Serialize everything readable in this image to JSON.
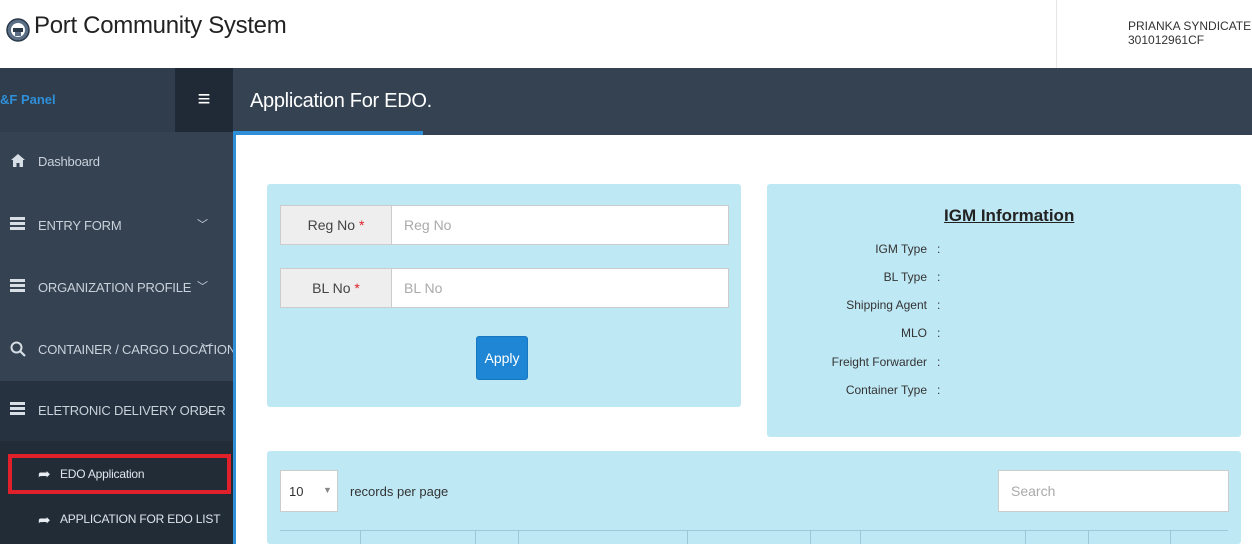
{
  "header": {
    "app_title": "Port Community System",
    "user_name": "PRIANKA SYNDICATE",
    "user_id": "301012961CF",
    "logo_icon": "port-logo-icon"
  },
  "sidebar": {
    "panel_label": "&F Panel",
    "toggle_icon": "hamburger-icon",
    "items": [
      {
        "label": "Dashboard",
        "icon": "home-icon"
      },
      {
        "label": "ENTRY FORM",
        "icon": "list-icon"
      },
      {
        "label": "ORGANIZATION PROFILE",
        "icon": "list-icon"
      },
      {
        "label": "CONTAINER / CARGO LOCATION",
        "icon": "search-icon"
      },
      {
        "label": "ELETRONIC DELIVERY ORDER",
        "icon": "list-icon"
      }
    ],
    "subitems": [
      {
        "label": "EDO Application",
        "icon": "share-arrow-icon",
        "active": true
      },
      {
        "label": "APPLICATION FOR EDO LIST",
        "icon": "share-arrow-icon",
        "active": false
      }
    ]
  },
  "main": {
    "page_title": "Application For EDO."
  },
  "form": {
    "reg_label": "Reg No",
    "reg_placeholder": "Reg No",
    "bl_label": "BL No",
    "bl_placeholder": "BL No",
    "required_mark": "*",
    "apply_label": "Apply"
  },
  "igm": {
    "title": "IGM Information",
    "fields": [
      {
        "label": "IGM Type",
        "value": ":"
      },
      {
        "label": "BL Type",
        "value": ":"
      },
      {
        "label": "Shipping Agent",
        "value": ":"
      },
      {
        "label": "MLO",
        "value": ":"
      },
      {
        "label": "Freight Forwarder",
        "value": ":"
      },
      {
        "label": "Container Type",
        "value": ":"
      }
    ]
  },
  "list": {
    "page_length": "10",
    "page_length_text": "records per page",
    "search_placeholder": "Search"
  },
  "colors": {
    "sidebar_bg": "#344252",
    "accent_blue": "#2f8fd8",
    "panel_bg": "#bfe8f5",
    "highlight_red": "#e0202a"
  }
}
